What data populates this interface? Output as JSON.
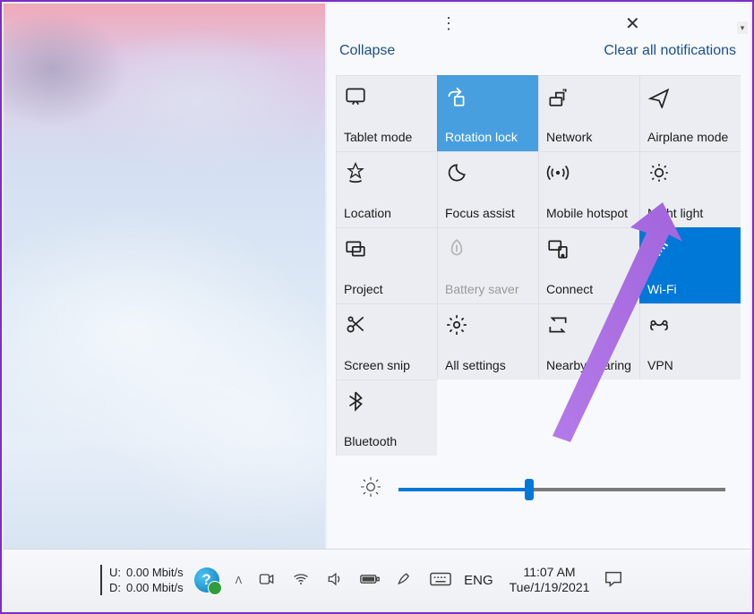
{
  "header": {
    "collapse": "Collapse",
    "clear": "Clear all notifications"
  },
  "tiles": [
    [
      {
        "k": "tablet",
        "label": "Tablet mode"
      },
      {
        "k": "rotation",
        "label": "Rotation lock",
        "state": "selected"
      },
      {
        "k": "network",
        "label": "Network"
      },
      {
        "k": "airplane",
        "label": "Airplane mode"
      }
    ],
    [
      {
        "k": "location",
        "label": "Location"
      },
      {
        "k": "focus",
        "label": "Focus assist"
      },
      {
        "k": "hotspot",
        "label": "Mobile hotspot"
      },
      {
        "k": "nightlight",
        "label": "Night light"
      }
    ],
    [
      {
        "k": "project",
        "label": "Project"
      },
      {
        "k": "battery",
        "label": "Battery saver",
        "state": "disabled"
      },
      {
        "k": "connect",
        "label": "Connect"
      },
      {
        "k": "wifi",
        "label": "Wi-Fi",
        "state": "on"
      }
    ],
    [
      {
        "k": "snip",
        "label": "Screen snip"
      },
      {
        "k": "settings",
        "label": "All settings"
      },
      {
        "k": "nearby",
        "label": "Nearby sharing"
      },
      {
        "k": "vpn",
        "label": "VPN"
      }
    ],
    [
      {
        "k": "bluetooth",
        "label": "Bluetooth"
      }
    ]
  ],
  "brightness": {
    "value": 40
  },
  "taskbar": {
    "net_u_label": "U:",
    "net_d_label": "D:",
    "net_u": "0.00 Mbit/s",
    "net_d": "0.00 Mbit/s",
    "lang": "ENG",
    "time": "11:07 AM",
    "date": "Tue/1/19/2021"
  }
}
